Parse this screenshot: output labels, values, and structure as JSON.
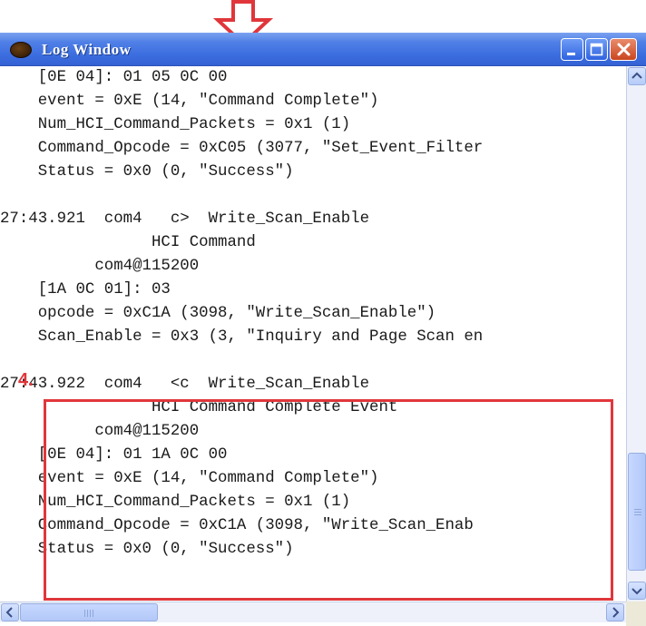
{
  "window": {
    "title": "Log Window",
    "titlebar_color": "#3b6ddf",
    "close_color": "#c9461f"
  },
  "annotation": {
    "step_number": "4.",
    "highlight_color": "#e0363b",
    "arrow_color": "#e0363b"
  },
  "log": {
    "lines": [
      "    [0E 04]: 01 05 0C 00",
      "    event = 0xE (14, \"Command Complete\")",
      "    Num_HCI_Command_Packets = 0x1 (1)",
      "    Command_Opcode = 0xC05 (3077, \"Set_Event_Filter",
      "    Status = 0x0 (0, \"Success\")",
      "",
      "27:43.921  com4   c>  Write_Scan_Enable",
      "                HCI Command",
      "          com4@115200",
      "    [1A 0C 01]: 03",
      "    opcode = 0xC1A (3098, \"Write_Scan_Enable\")",
      "    Scan_Enable = 0x3 (3, \"Inquiry and Page Scan en",
      "",
      "27:43.922  com4   <c  Write_Scan_Enable",
      "                HCI Command Complete Event",
      "          com4@115200",
      "    [0E 04]: 01 1A 0C 00",
      "    event = 0xE (14, \"Command Complete\")",
      "    Num_HCI_Command_Packets = 0x1 (1)",
      "    Command_Opcode = 0xC1A (3098, \"Write_Scan_Enab",
      "    Status = 0x0 (0, \"Success\")"
    ]
  },
  "icons": {
    "app": "log-app-icon",
    "minimize": "minimize-icon",
    "maximize": "maximize-icon",
    "close": "close-icon",
    "scroll_up": "scroll-up-arrow-icon",
    "scroll_down": "scroll-down-arrow-icon",
    "scroll_left": "scroll-left-arrow-icon",
    "scroll_right": "scroll-right-arrow-icon"
  }
}
